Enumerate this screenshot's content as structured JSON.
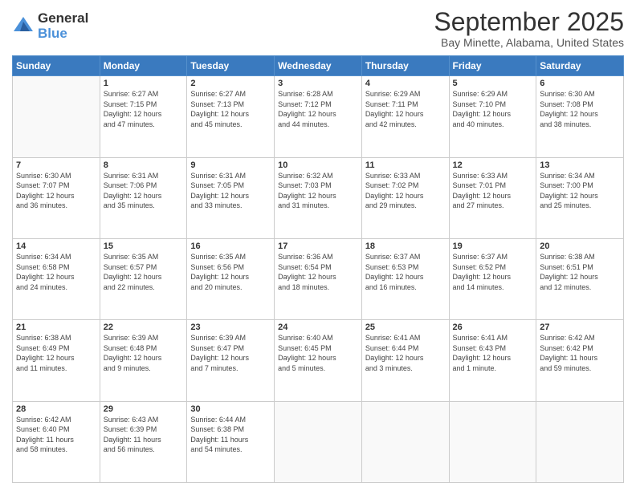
{
  "logo": {
    "general": "General",
    "blue": "Blue"
  },
  "header": {
    "title": "September 2025",
    "subtitle": "Bay Minette, Alabama, United States"
  },
  "weekdays": [
    "Sunday",
    "Monday",
    "Tuesday",
    "Wednesday",
    "Thursday",
    "Friday",
    "Saturday"
  ],
  "weeks": [
    [
      {
        "day": "",
        "info": ""
      },
      {
        "day": "1",
        "info": "Sunrise: 6:27 AM\nSunset: 7:15 PM\nDaylight: 12 hours\nand 47 minutes."
      },
      {
        "day": "2",
        "info": "Sunrise: 6:27 AM\nSunset: 7:13 PM\nDaylight: 12 hours\nand 45 minutes."
      },
      {
        "day": "3",
        "info": "Sunrise: 6:28 AM\nSunset: 7:12 PM\nDaylight: 12 hours\nand 44 minutes."
      },
      {
        "day": "4",
        "info": "Sunrise: 6:29 AM\nSunset: 7:11 PM\nDaylight: 12 hours\nand 42 minutes."
      },
      {
        "day": "5",
        "info": "Sunrise: 6:29 AM\nSunset: 7:10 PM\nDaylight: 12 hours\nand 40 minutes."
      },
      {
        "day": "6",
        "info": "Sunrise: 6:30 AM\nSunset: 7:08 PM\nDaylight: 12 hours\nand 38 minutes."
      }
    ],
    [
      {
        "day": "7",
        "info": "Sunrise: 6:30 AM\nSunset: 7:07 PM\nDaylight: 12 hours\nand 36 minutes."
      },
      {
        "day": "8",
        "info": "Sunrise: 6:31 AM\nSunset: 7:06 PM\nDaylight: 12 hours\nand 35 minutes."
      },
      {
        "day": "9",
        "info": "Sunrise: 6:31 AM\nSunset: 7:05 PM\nDaylight: 12 hours\nand 33 minutes."
      },
      {
        "day": "10",
        "info": "Sunrise: 6:32 AM\nSunset: 7:03 PM\nDaylight: 12 hours\nand 31 minutes."
      },
      {
        "day": "11",
        "info": "Sunrise: 6:33 AM\nSunset: 7:02 PM\nDaylight: 12 hours\nand 29 minutes."
      },
      {
        "day": "12",
        "info": "Sunrise: 6:33 AM\nSunset: 7:01 PM\nDaylight: 12 hours\nand 27 minutes."
      },
      {
        "day": "13",
        "info": "Sunrise: 6:34 AM\nSunset: 7:00 PM\nDaylight: 12 hours\nand 25 minutes."
      }
    ],
    [
      {
        "day": "14",
        "info": "Sunrise: 6:34 AM\nSunset: 6:58 PM\nDaylight: 12 hours\nand 24 minutes."
      },
      {
        "day": "15",
        "info": "Sunrise: 6:35 AM\nSunset: 6:57 PM\nDaylight: 12 hours\nand 22 minutes."
      },
      {
        "day": "16",
        "info": "Sunrise: 6:35 AM\nSunset: 6:56 PM\nDaylight: 12 hours\nand 20 minutes."
      },
      {
        "day": "17",
        "info": "Sunrise: 6:36 AM\nSunset: 6:54 PM\nDaylight: 12 hours\nand 18 minutes."
      },
      {
        "day": "18",
        "info": "Sunrise: 6:37 AM\nSunset: 6:53 PM\nDaylight: 12 hours\nand 16 minutes."
      },
      {
        "day": "19",
        "info": "Sunrise: 6:37 AM\nSunset: 6:52 PM\nDaylight: 12 hours\nand 14 minutes."
      },
      {
        "day": "20",
        "info": "Sunrise: 6:38 AM\nSunset: 6:51 PM\nDaylight: 12 hours\nand 12 minutes."
      }
    ],
    [
      {
        "day": "21",
        "info": "Sunrise: 6:38 AM\nSunset: 6:49 PM\nDaylight: 12 hours\nand 11 minutes."
      },
      {
        "day": "22",
        "info": "Sunrise: 6:39 AM\nSunset: 6:48 PM\nDaylight: 12 hours\nand 9 minutes."
      },
      {
        "day": "23",
        "info": "Sunrise: 6:39 AM\nSunset: 6:47 PM\nDaylight: 12 hours\nand 7 minutes."
      },
      {
        "day": "24",
        "info": "Sunrise: 6:40 AM\nSunset: 6:45 PM\nDaylight: 12 hours\nand 5 minutes."
      },
      {
        "day": "25",
        "info": "Sunrise: 6:41 AM\nSunset: 6:44 PM\nDaylight: 12 hours\nand 3 minutes."
      },
      {
        "day": "26",
        "info": "Sunrise: 6:41 AM\nSunset: 6:43 PM\nDaylight: 12 hours\nand 1 minute."
      },
      {
        "day": "27",
        "info": "Sunrise: 6:42 AM\nSunset: 6:42 PM\nDaylight: 11 hours\nand 59 minutes."
      }
    ],
    [
      {
        "day": "28",
        "info": "Sunrise: 6:42 AM\nSunset: 6:40 PM\nDaylight: 11 hours\nand 58 minutes."
      },
      {
        "day": "29",
        "info": "Sunrise: 6:43 AM\nSunset: 6:39 PM\nDaylight: 11 hours\nand 56 minutes."
      },
      {
        "day": "30",
        "info": "Sunrise: 6:44 AM\nSunset: 6:38 PM\nDaylight: 11 hours\nand 54 minutes."
      },
      {
        "day": "",
        "info": ""
      },
      {
        "day": "",
        "info": ""
      },
      {
        "day": "",
        "info": ""
      },
      {
        "day": "",
        "info": ""
      }
    ]
  ]
}
